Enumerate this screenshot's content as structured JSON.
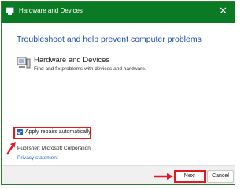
{
  "window": {
    "title": "Hardware and Devices",
    "titlebar_color": "#0b7a24",
    "close_glyph": "✕"
  },
  "main": {
    "heading": "Troubleshoot and help prevent computer problems",
    "item": {
      "icon": "hardware-icon",
      "title": "Hardware and Devices",
      "description": "Find and fix problems with devices and hardware."
    },
    "apply_repairs": {
      "label": "Apply repairs automatically",
      "checked": true
    },
    "publisher": "Publisher:  Microsoft Corporation",
    "privacy_link": "Privacy statement"
  },
  "footer": {
    "next_label": "Next",
    "cancel_label": "Cancel"
  },
  "annotations": {
    "highlight_color": "#e01b24"
  }
}
